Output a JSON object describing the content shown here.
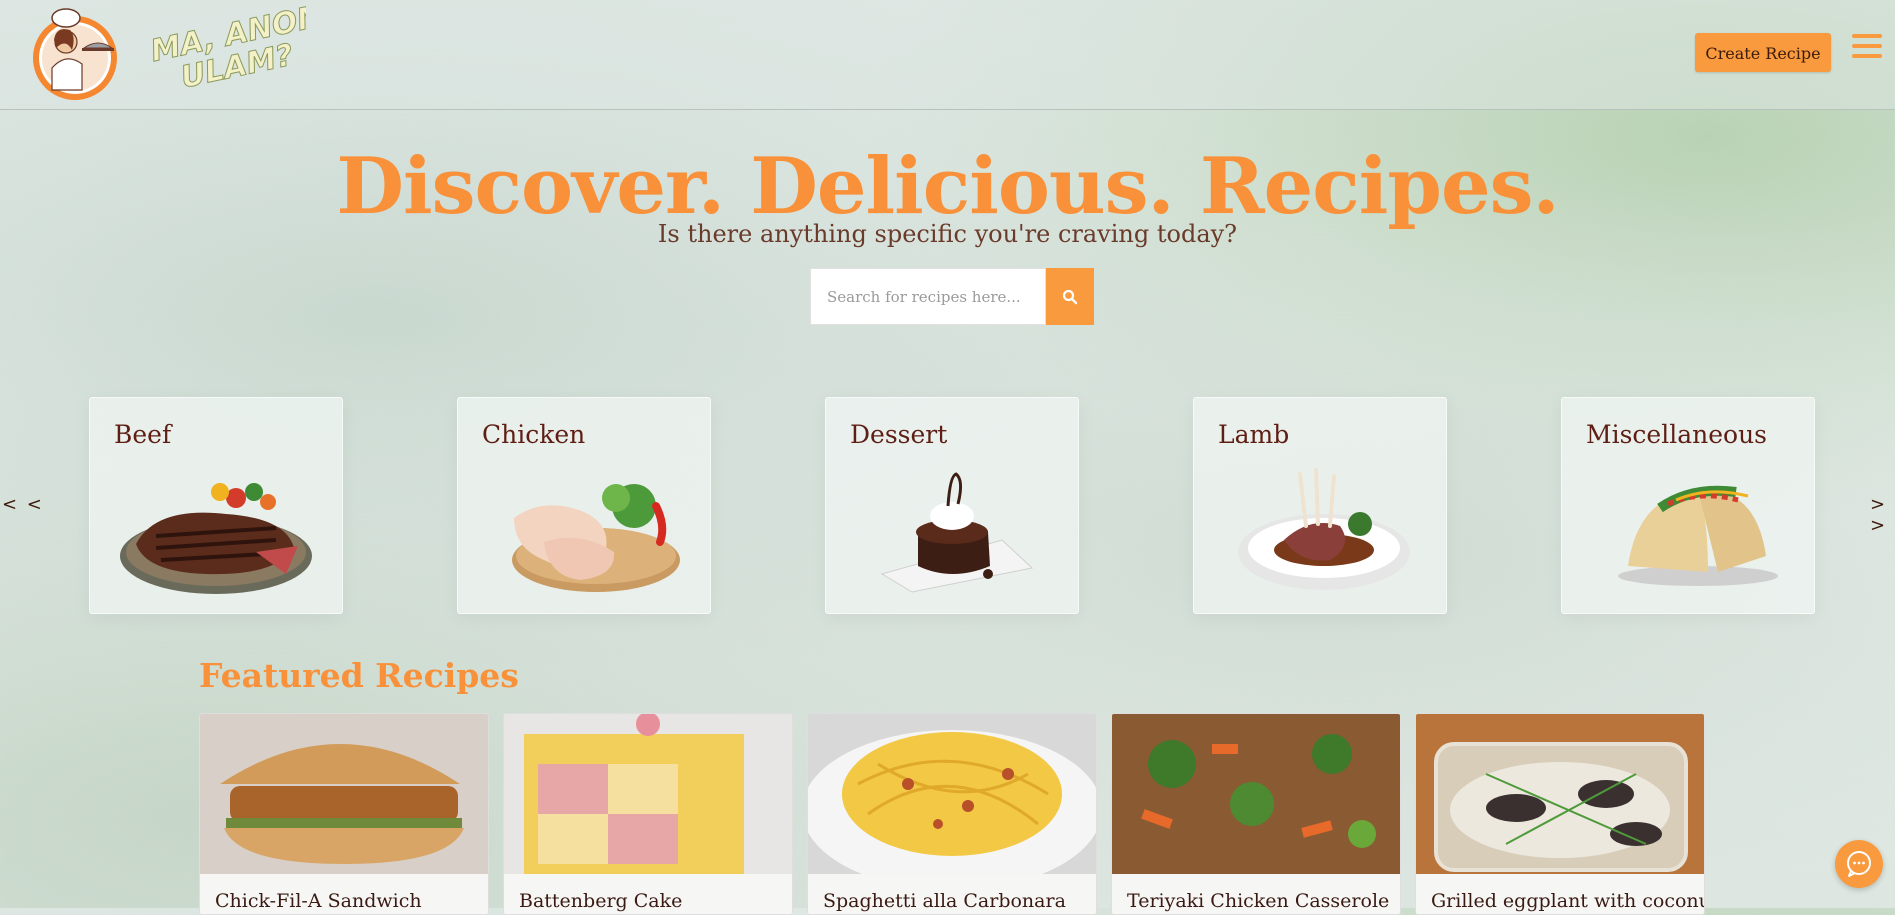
{
  "header": {
    "logo_alt": "Ma, Anong Ulam?",
    "logo_text_line1": "MA, ANONG",
    "logo_text_line2": "ULAM?",
    "create_button": "Create Recipe"
  },
  "hero": {
    "title": "Discover. Delicious. Recipes.",
    "subtitle": "Is there anything specific you're craving today?",
    "search_placeholder": "Search for recipes here..."
  },
  "carousel": {
    "prev_label": "< <",
    "next_label": "> >",
    "categories": [
      {
        "label": "Beef",
        "icon": "steak-plate"
      },
      {
        "label": "Chicken",
        "icon": "raw-chicken-legs"
      },
      {
        "label": "Dessert",
        "icon": "chocolate-lava-cake"
      },
      {
        "label": "Lamb",
        "icon": "lamb-chops-plate"
      },
      {
        "label": "Miscellaneous",
        "icon": "tacos"
      }
    ]
  },
  "featured": {
    "title": "Featured Recipes",
    "recipes": [
      {
        "name": "Chick-Fil-A Sandwich"
      },
      {
        "name": "Battenberg Cake"
      },
      {
        "name": "Spaghetti alla Carbonara"
      },
      {
        "name": "Teriyaki Chicken Casserole"
      },
      {
        "name": "Grilled eggplant with coconut"
      }
    ]
  },
  "colors": {
    "accent": "#f89a3d",
    "title_orange": "#f8913a",
    "text_dark": "#5e1e14"
  }
}
